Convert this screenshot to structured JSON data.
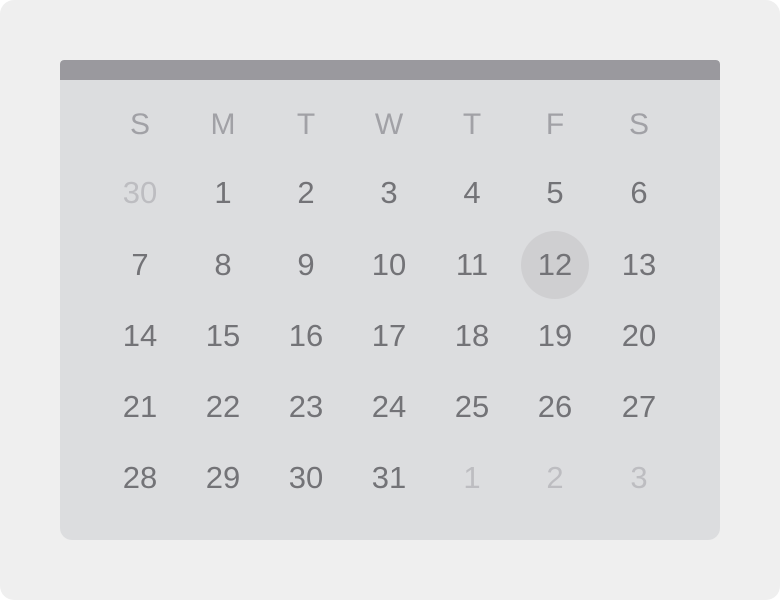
{
  "weekdays": [
    "S",
    "M",
    "T",
    "W",
    "T",
    "F",
    "S"
  ],
  "weeks": [
    [
      {
        "d": "30",
        "muted": true
      },
      {
        "d": "1"
      },
      {
        "d": "2"
      },
      {
        "d": "3"
      },
      {
        "d": "4"
      },
      {
        "d": "5"
      },
      {
        "d": "6"
      }
    ],
    [
      {
        "d": "7"
      },
      {
        "d": "8"
      },
      {
        "d": "9"
      },
      {
        "d": "10"
      },
      {
        "d": "11"
      },
      {
        "d": "12",
        "selected": true
      },
      {
        "d": "13"
      }
    ],
    [
      {
        "d": "14"
      },
      {
        "d": "15"
      },
      {
        "d": "16"
      },
      {
        "d": "17"
      },
      {
        "d": "18"
      },
      {
        "d": "19"
      },
      {
        "d": "20"
      }
    ],
    [
      {
        "d": "21"
      },
      {
        "d": "22"
      },
      {
        "d": "23"
      },
      {
        "d": "24"
      },
      {
        "d": "25"
      },
      {
        "d": "26"
      },
      {
        "d": "27"
      }
    ],
    [
      {
        "d": "28"
      },
      {
        "d": "29"
      },
      {
        "d": "30"
      },
      {
        "d": "31"
      },
      {
        "d": "1",
        "muted": true
      },
      {
        "d": "2",
        "muted": true
      },
      {
        "d": "3",
        "muted": true
      }
    ]
  ],
  "colors": {
    "frame": "#efefef",
    "calendar": "#dcdddf",
    "header_bar": "#9a999e",
    "weekday_text": "#a1a1a6",
    "day_text": "#737377",
    "muted_text": "#bdbdc1",
    "selected_circle": "#cfcfd1"
  }
}
